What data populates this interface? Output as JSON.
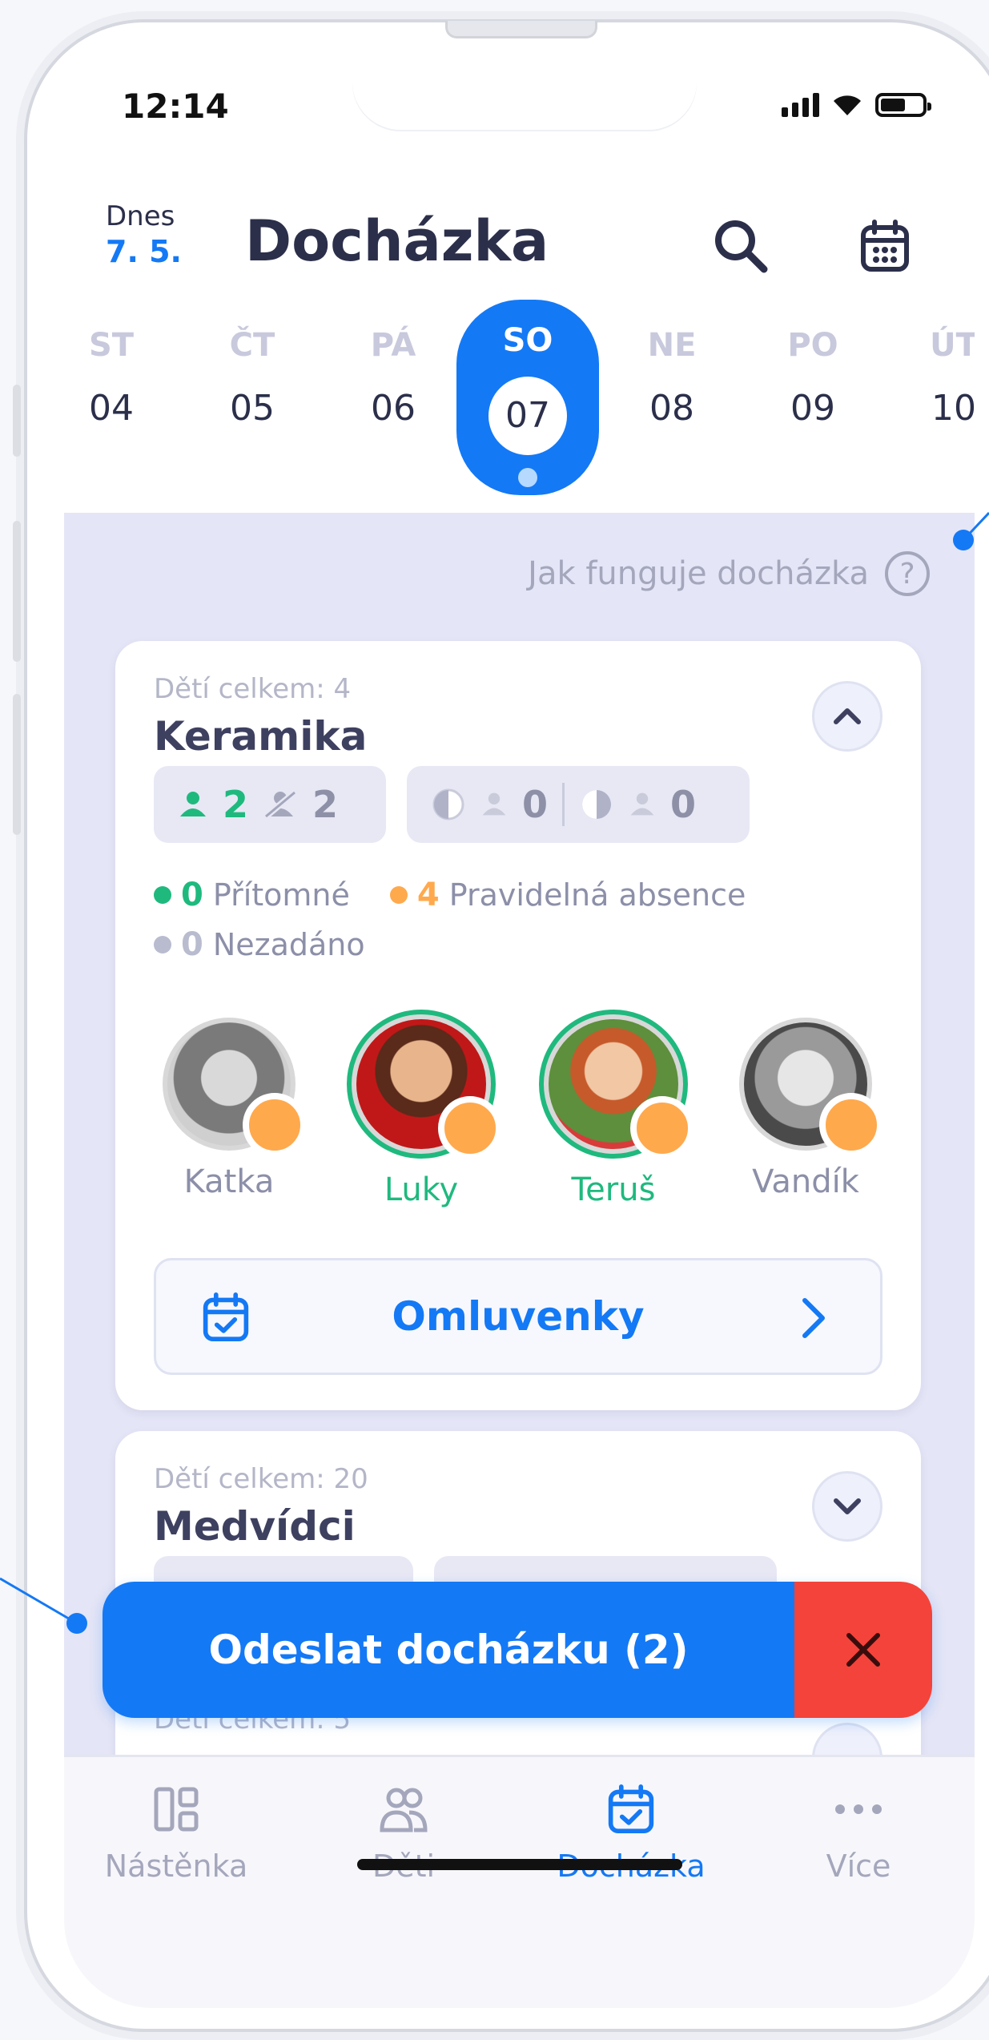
{
  "status": {
    "time": "12:14"
  },
  "header": {
    "today_label": "Dnes",
    "today_date": "7. 5.",
    "title": "Docházka"
  },
  "days": [
    {
      "name": "ST",
      "num": "04"
    },
    {
      "name": "ČT",
      "num": "05"
    },
    {
      "name": "PÁ",
      "num": "06"
    },
    {
      "name": "SO",
      "num": "07",
      "active": true
    },
    {
      "name": "NE",
      "num": "08"
    },
    {
      "name": "PO",
      "num": "09"
    },
    {
      "name": "ÚT",
      "num": "10"
    }
  ],
  "help": {
    "label": "Jak funguje docházka",
    "icon": "?"
  },
  "cards": [
    {
      "total": "Dětí celkem: 4",
      "name": "Keramika",
      "present_count": "2",
      "absent_count": "2",
      "half_a": "0",
      "half_b": "0",
      "legend": {
        "present_num": "0",
        "present_label": "Přítomné",
        "regular_num": "4",
        "regular_label": "Pravidelná absence",
        "unset_num": "0",
        "unset_label": "Nezadáno"
      },
      "kids": [
        "Katka",
        "Luky",
        "Teruš",
        "Vandík"
      ],
      "excuses_label": "Omluvenky"
    },
    {
      "total": "Dětí celkem: 20",
      "name": "Medvídci"
    },
    {
      "total": "Dětí celkem: 5"
    }
  ],
  "submit": {
    "label": "Odeslat docházku (2)"
  },
  "tabs": [
    "Nástěnka",
    "Děti",
    "Docházka",
    "Více"
  ],
  "colors": {
    "accent": "#1479f5",
    "green": "#1fb97e",
    "orange": "#ffa94d",
    "red": "#f4433a",
    "background": "#e4e5f6"
  }
}
